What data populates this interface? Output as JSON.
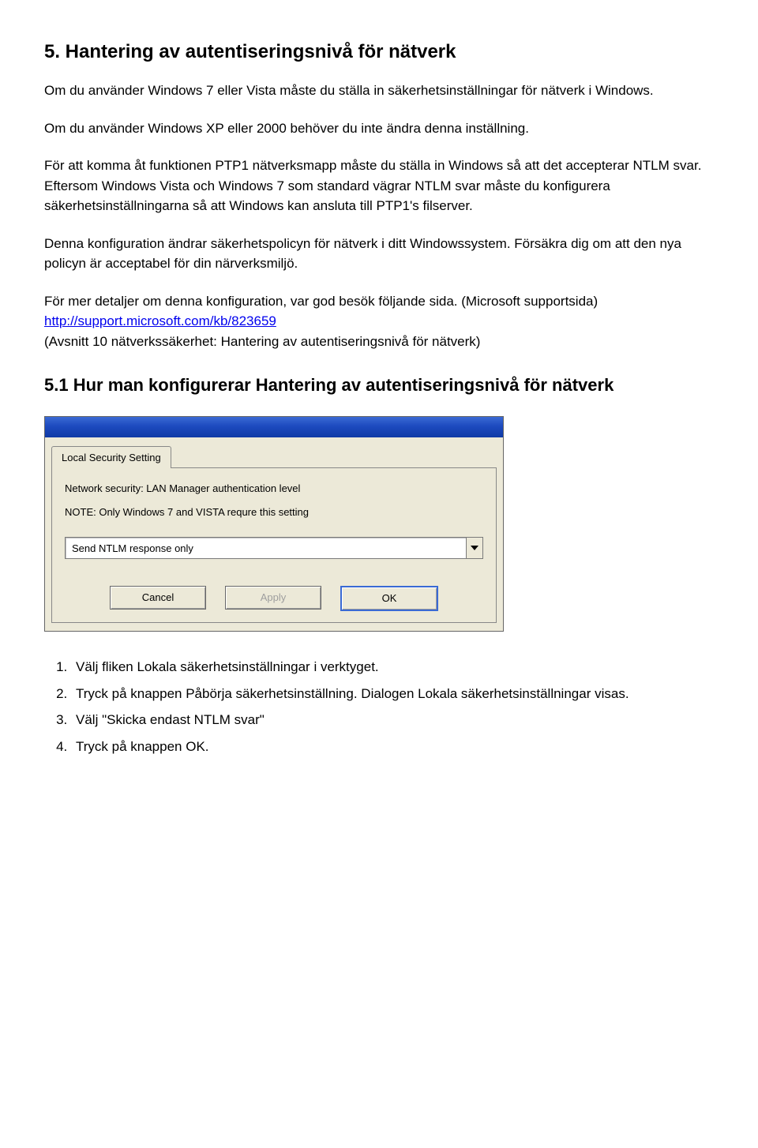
{
  "title": "5. Hantering av autentiseringsnivå för nätverk",
  "p1": "Om du använder Windows 7 eller Vista måste du ställa in säkerhetsinställningar för nätverk i Windows.",
  "p2": "Om du använder Windows XP eller 2000 behöver du inte ändra denna inställning.",
  "p3": "För att komma åt funktionen PTP1 nätverksmapp måste du ställa in Windows så att det accepterar NTLM svar.",
  "p4": "Eftersom Windows Vista och Windows 7 som standard vägrar NTLM svar måste du konfigurera säkerhetsinställningarna så att Windows kan ansluta till PTP1's filserver.",
  "p5": "Denna konfiguration ändrar säkerhetspolicyn för nätverk i ditt Windowssystem. Försäkra dig om att den nya policyn är acceptabel för din närverksmiljö.",
  "p6a": "För mer detaljer om denna konfiguration, var god besök följande sida. (Microsoft supportsida)",
  "link": "http://support.microsoft.com/kb/823659",
  "p6b": "(Avsnitt 10 nätverkssäkerhet: Hantering av autentiseringsnivå för nätverk)",
  "subtitle": "5.1 Hur man konfigurerar Hantering av autentiseringsnivå för nätverk",
  "dialog": {
    "tab": "Local Security Setting",
    "label": "Network security: LAN Manager authentication level",
    "note": "NOTE: Only Windows 7 and VISTA requre this setting",
    "value": "Send NTLM response only",
    "cancel": "Cancel",
    "apply": "Apply",
    "ok": "OK"
  },
  "steps": {
    "s1": "Välj fliken Lokala säkerhetsinställningar i verktyget.",
    "s2": "Tryck på knappen Påbörja säkerhetsinställning. Dialogen Lokala säkerhetsinställningar visas.",
    "s3": "Välj \"Skicka endast NTLM svar\"",
    "s4": "Tryck på knappen OK."
  }
}
